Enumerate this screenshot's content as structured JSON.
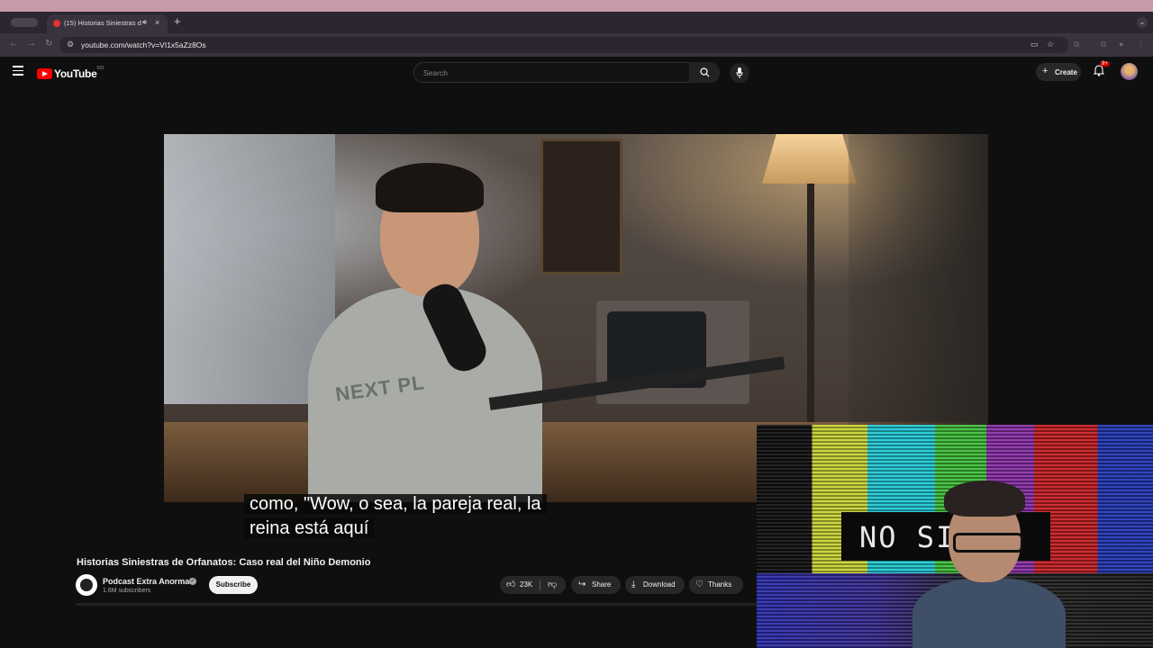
{
  "browser": {
    "tab_title": "(15) Historias Siniestras d",
    "tab_close": "×",
    "new_tab": "+",
    "url": "youtube.com/watch?v=VI1x5aZz8Os"
  },
  "youtube": {
    "logo_text": "YouTube",
    "logo_country": "CO",
    "search_placeholder": "Search",
    "create_label": "Create",
    "notif_count": "9+"
  },
  "video": {
    "shirt_text": "NEXT PL",
    "subtitle_line1": "como, \"Wow, o sea, la pareja real, la",
    "subtitle_line2": "reina está aquí",
    "title": "Historias Siniestras de Orfanatos: Caso real del Niño Demonio",
    "channel_name": "Podcast Extra Anormal",
    "channel_subs": "1.6M subscribers",
    "subscribe_label": "Subscribe",
    "like_count": "23K",
    "share_label": "Share",
    "download_label": "Download",
    "thanks_label": "Thanks"
  },
  "webcam": {
    "overlay_text": "NO SI"
  },
  "colors": {
    "accent_red": "#ff0000",
    "background": "#0f0f0f"
  }
}
